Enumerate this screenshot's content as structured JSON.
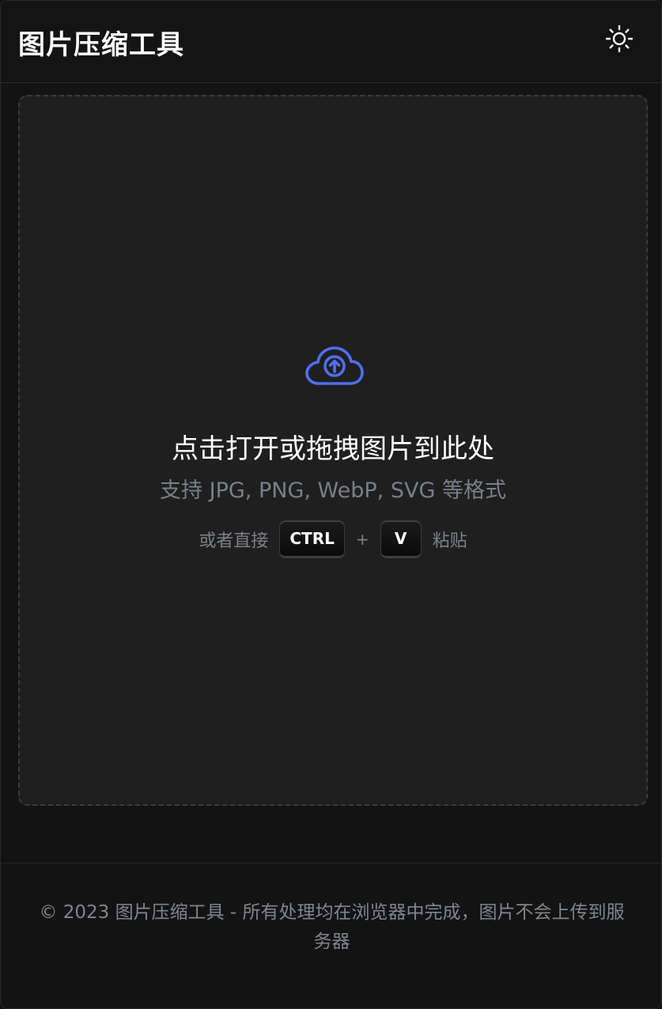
{
  "header": {
    "title": "图片压缩工具",
    "theme_icon": "sun-icon"
  },
  "dropzone": {
    "icon": "cloud-upload-icon",
    "title": "点击打开或拖拽图片到此处",
    "formats": "支持 JPG, PNG, WebP, SVG 等格式",
    "paste_prefix": "或者直接",
    "key_ctrl": "CTRL",
    "plus": "+",
    "key_v": "V",
    "paste_suffix": "粘贴"
  },
  "footer": {
    "text": "© 2023 图片压缩工具 - 所有处理均在浏览器中完成，图片不会上传到服务器"
  },
  "colors": {
    "background": "#131313",
    "dropzone_bg": "#1f1f1f",
    "accent_icon": "#4f6ef7",
    "muted_text": "#7a7f87"
  }
}
